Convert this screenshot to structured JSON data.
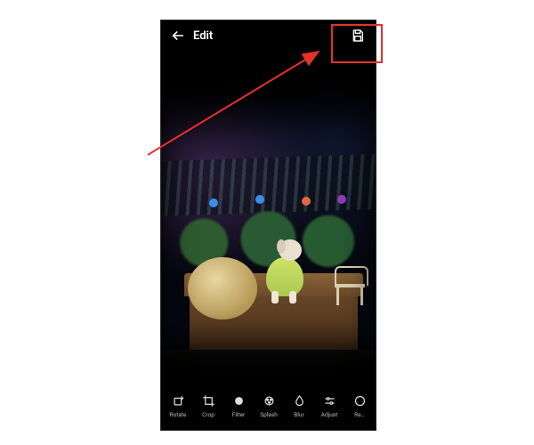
{
  "header": {
    "title": "Edit"
  },
  "tools": [
    {
      "id": "rotate",
      "label": "Rotate"
    },
    {
      "id": "crop",
      "label": "Crop"
    },
    {
      "id": "filter",
      "label": "Filter"
    },
    {
      "id": "splash",
      "label": "Splash"
    },
    {
      "id": "blur",
      "label": "Blur"
    },
    {
      "id": "adjust",
      "label": "Adjust"
    },
    {
      "id": "more",
      "label": "Re…"
    }
  ],
  "annotation": {
    "highlight": "save-button",
    "color": "#e53228"
  }
}
